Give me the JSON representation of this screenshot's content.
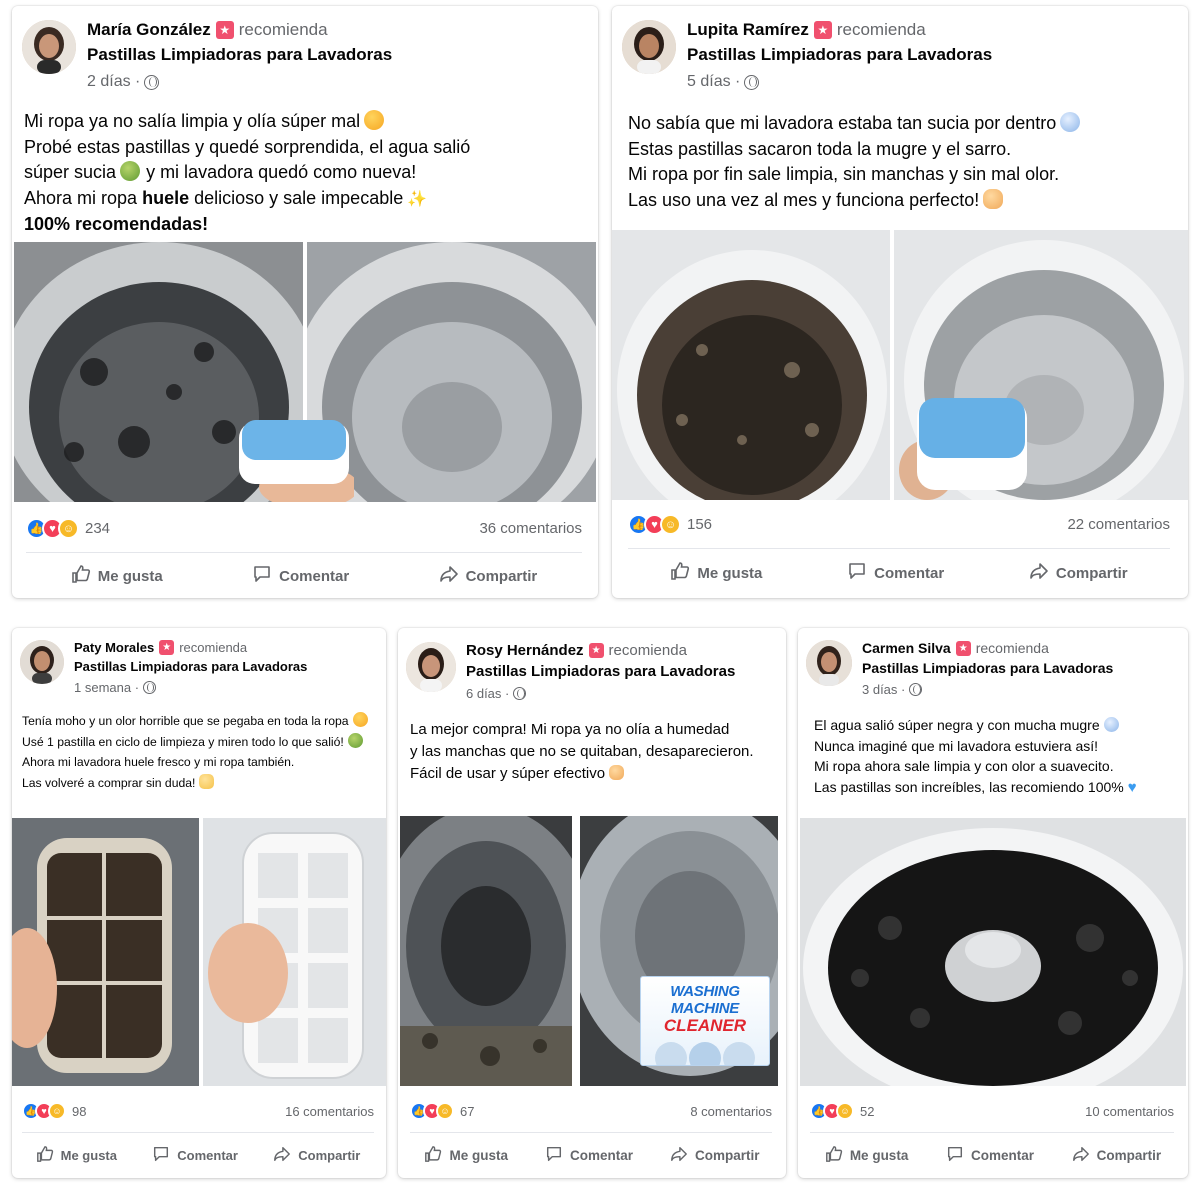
{
  "posts": [
    {
      "author": "María González",
      "recommends": "recomienda",
      "product": "Pastillas Limpiadoras para Lavadoras",
      "time": "2 días",
      "lines": [
        "Mi ropa ya no salía limpia y olía súper mal",
        "Probé estas pastillas y quedé sorprendida, el agua salió",
        "súper sucia",
        "y mi lavadora quedó como nueva!",
        "Ahora mi ropa",
        "huele",
        "delicioso y sale impecable",
        "100% recomendadas!"
      ],
      "reaction_count": "234",
      "comments": "36 comentarios"
    },
    {
      "author": "Lupita Ramírez",
      "recommends": "recomienda",
      "product": "Pastillas Limpiadoras para Lavadoras",
      "time": "5 días",
      "lines": [
        "No sabía que mi lavadora estaba tan sucia por dentro",
        "Estas pastillas sacaron toda la mugre y el sarro.",
        "Mi ropa por fin sale limpia, sin manchas y sin mal olor.",
        "Las uso una vez al mes y funciona perfecto!"
      ],
      "reaction_count": "156",
      "comments": "22 comentarios"
    },
    {
      "author": "Paty Morales",
      "recommends": "recomienda",
      "product": "Pastillas Limpiadoras para Lavadoras",
      "time": "1 semana",
      "lines": [
        "Tenía moho y un olor horrible que se pegaba en toda la ropa",
        "Usé 1 pastilla en ciclo de limpieza y miren todo lo que salió!",
        "Ahora mi lavadora huele fresco y mi ropa también.",
        "Las volveré a comprar sin duda!"
      ],
      "reaction_count": "98",
      "comments": "16 comentarios"
    },
    {
      "author": "Rosy Hernández",
      "recommends": "recomienda",
      "product": "Pastillas Limpiadoras para Lavadoras",
      "time": "6 días",
      "lines": [
        "La mejor compra! Mi ropa ya no olía a humedad",
        "y las manchas que no se quitaban, desaparecieron.",
        "Fácil de usar y súper efectivo"
      ],
      "reaction_count": "67",
      "comments": "8 comentarios",
      "package_text": [
        "WASHING MACHINE",
        "CLEANER"
      ]
    },
    {
      "author": "Carmen Silva",
      "recommends": "recomienda",
      "product": "Pastillas Limpiadoras para Lavadoras",
      "time": "3 días",
      "lines": [
        "El agua salió súper negra y con mucha mugre",
        "Nunca imaginé que mi lavadora estuviera así!",
        "Mi ropa ahora sale limpia y con olor a suavecito.",
        "Las pastillas son increíbles, las recomiendo 100%"
      ],
      "reaction_count": "52",
      "comments": "10 comentarios"
    }
  ],
  "actions": {
    "like": "Me gusta",
    "comment": "Comentar",
    "share": "Compartir"
  },
  "colors": {
    "like_blue": "#1877f2",
    "love_red": "#f33e58",
    "haha_yellow": "#f7b928",
    "badge_pink": "#f0506e",
    "muted_text": "#65676b"
  },
  "icons": [
    "recommend-badge-icon",
    "globe-icon",
    "like-reaction-icon",
    "love-reaction-icon",
    "haha-reaction-icon",
    "thumbs-up-icon",
    "comment-bubble-icon",
    "share-arrow-icon"
  ]
}
